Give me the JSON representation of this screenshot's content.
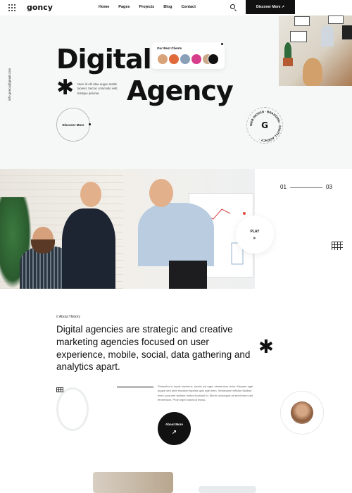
{
  "header": {
    "logo": "goncy",
    "nav": [
      "Home",
      "Pages",
      "Projects",
      "Blog",
      "Contact"
    ],
    "discover_label": "Discover More ↗"
  },
  "hero": {
    "email": "info.goncy@gmail.com",
    "title_line1": "Digital",
    "title_line2": "Agency",
    "description": "Nunc id elit vitae augue mattis laoreet. Sed ac commodo velit, tristique pulvinar.",
    "clients_title": "Our Best Clients",
    "discover_circle_label": "Discover More",
    "badge_text": "WEB DESIGN · BRANDING · DIGITAL AGENCY ·",
    "badge_letter": "G"
  },
  "slider": {
    "current": "01",
    "total": "03",
    "play_label": "PLAY"
  },
  "about": {
    "kicker": "// About History",
    "heading": "Digital agencies are strategic and creative marketing agencies focused on user experience, mobile, social, data gathering and analytics apart.",
    "body": "Phasellus in turpis maximus, iaculis est eget, elementum dolor. Aliquam eget augue sed ante tincidunt facilisis quis eget sem. Vestibulum efficitur facilisis enim, posuere facilisis metus tincidunt id. Morbi consequat at amet enim sed fermentum. Proin eget euismod lectus.",
    "button_label": "About More",
    "button_arrow": "↗"
  },
  "colors": {
    "accent": "#111111",
    "hero_bg": "#f6f8f7"
  }
}
